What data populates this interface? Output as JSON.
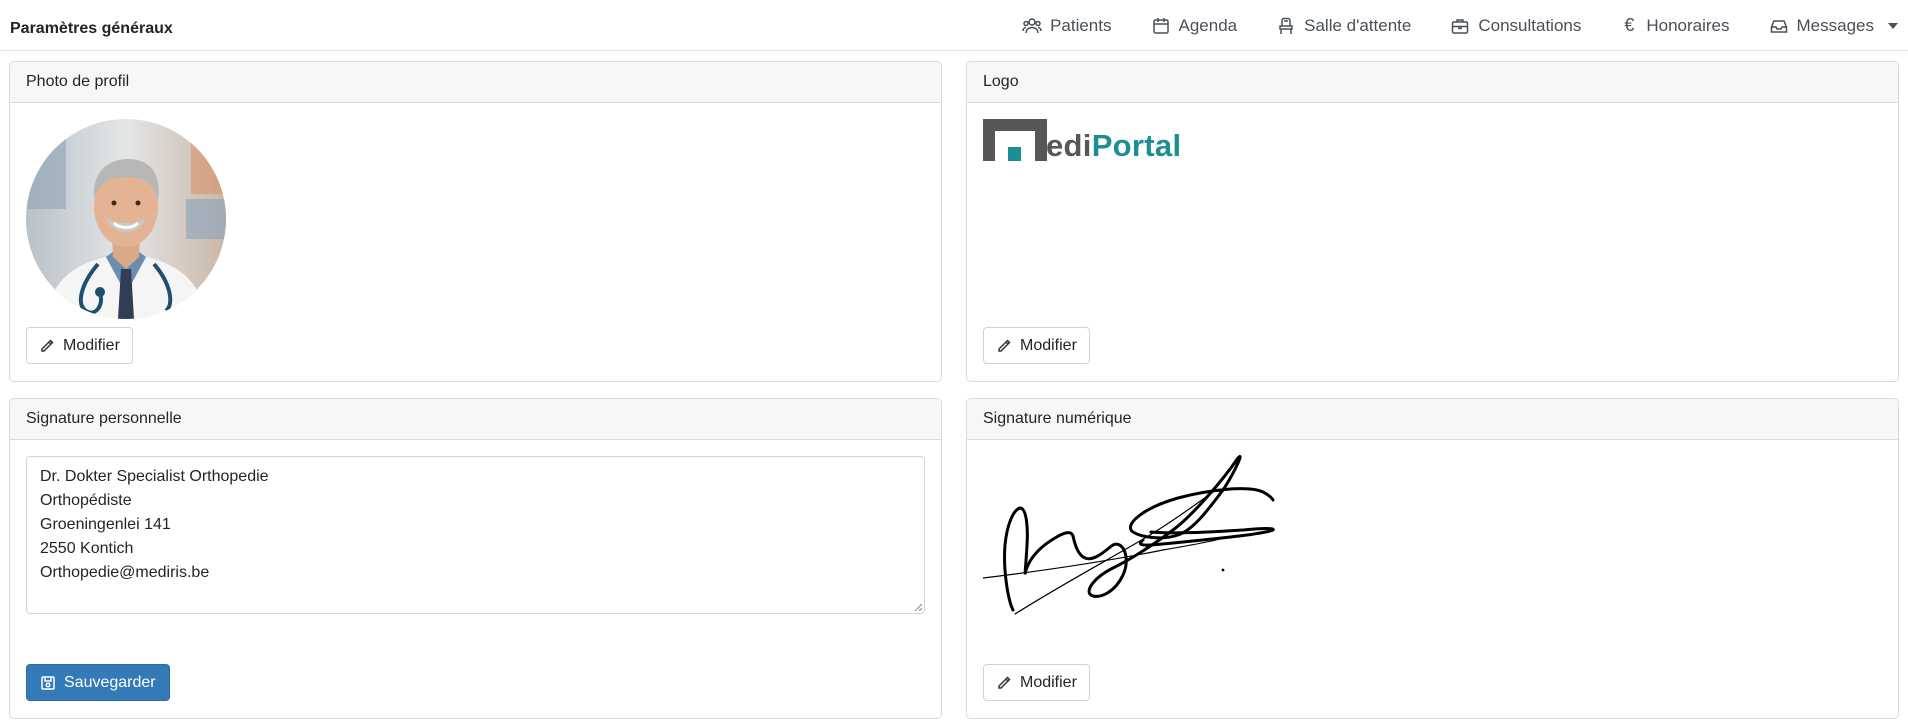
{
  "header": {
    "title": "Paramètres généraux",
    "nav": [
      {
        "label": "Patients",
        "icon": "users-icon"
      },
      {
        "label": "Agenda",
        "icon": "calendar-icon"
      },
      {
        "label": "Salle d'attente",
        "icon": "chair-icon"
      },
      {
        "label": "Consultations",
        "icon": "briefcase-icon"
      },
      {
        "label": "Honoraires",
        "icon": "euro-icon"
      },
      {
        "label": "Messages",
        "icon": "inbox-icon"
      }
    ]
  },
  "profile_photo": {
    "title": "Photo de profil",
    "edit_label": "Modifier"
  },
  "logo": {
    "title": "Logo",
    "text_dark": "edi",
    "text_teal": "Portal",
    "edit_label": "Modifier",
    "colors": {
      "dark": "#555759",
      "teal": "#1d8f94"
    }
  },
  "personal_signature": {
    "title": "Signature personnelle",
    "lines": [
      "Dr. Dokter Specialist Orthopedie",
      "Orthopédiste",
      "Groeningenlei 141",
      "2550 Kontich",
      "Orthopedie@mediris.be"
    ],
    "save_label": "Sauvegarder"
  },
  "digital_signature": {
    "title": "Signature numérique",
    "edit_label": "Modifier"
  },
  "colors": {
    "primary": "#337ab7",
    "card_header_bg": "#f7f7f7",
    "border": "#d8dadc"
  }
}
